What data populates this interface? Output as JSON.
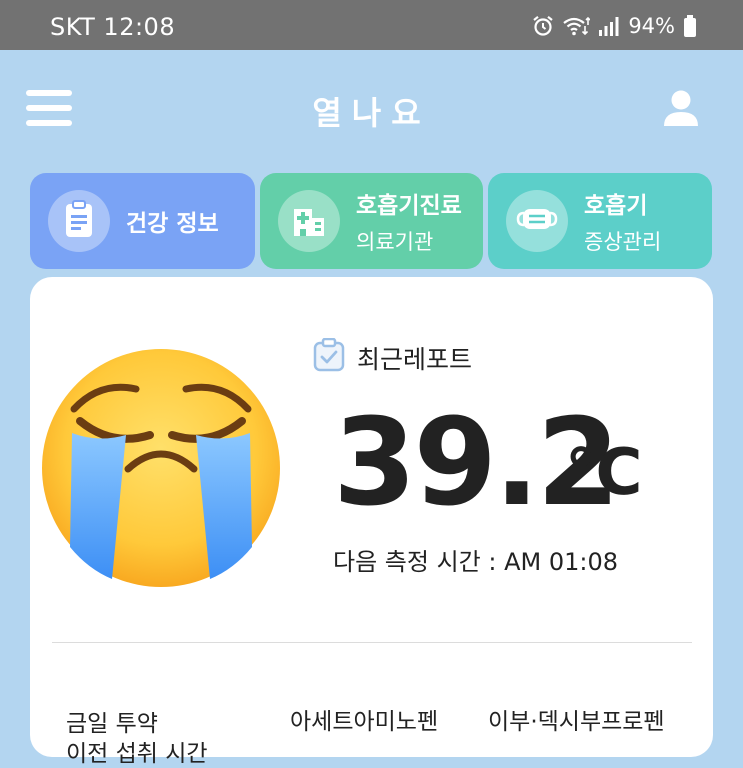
{
  "status_bar": {
    "carrier": "SKT",
    "time": "12:08",
    "battery": "94%",
    "icons": [
      "alarm-icon",
      "wifi-icon",
      "signal-icon",
      "battery-icon"
    ]
  },
  "header": {
    "title": "열나요",
    "icons": [
      "menu-icon",
      "user-icon"
    ]
  },
  "tabs": [
    {
      "line1": "건강 정보",
      "icon": "clipboard-icon",
      "color": "#7aa3f5"
    },
    {
      "line1": "호흡기진료",
      "line2": "의료기관",
      "icon": "hospital-icon",
      "color": "#63cfa9"
    },
    {
      "line1": "호흡기",
      "line2": "증상관리",
      "icon": "mask-icon",
      "color": "#5ccfc9"
    }
  ],
  "report": {
    "label": "최근레포트",
    "temperature": "39.2",
    "unit": "℃",
    "next_measure": "다음 측정 시간 : AM 01:08",
    "status_emoji": "crying-face-emoji"
  },
  "medication": {
    "label": "금일 투약",
    "sub_label": "이전 섭취 시간",
    "items": [
      "아세트아미노펜",
      "이부·덱시부프로펜"
    ]
  }
}
